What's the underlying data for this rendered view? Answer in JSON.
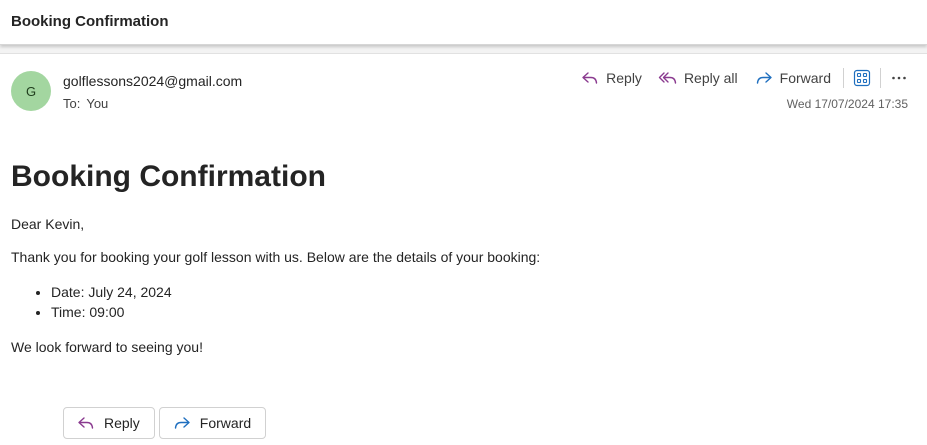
{
  "subject": "Booking Confirmation",
  "sender": {
    "initial": "G",
    "email": "golflessons2024@gmail.com",
    "to_label": "To:",
    "to_value": "You"
  },
  "toolbar": {
    "reply_label": "Reply",
    "reply_all_label": "Reply all",
    "forward_label": "Forward",
    "apps_icon": "apps-grid-icon",
    "more_icon": "more-horizontal-icon"
  },
  "timestamp": "Wed 17/07/2024 17:35",
  "body": {
    "heading": "Booking Confirmation",
    "greeting": "Dear Kevin,",
    "intro": "Thank you for booking your golf lesson with us. Below are the details of your booking:",
    "details": [
      "Date: July 24, 2024",
      "Time: 09:00"
    ],
    "closing": "We look forward to seeing you!"
  },
  "bottom_actions": {
    "reply_label": "Reply",
    "forward_label": "Forward"
  },
  "colors": {
    "reply_icon": "#8a3a8f",
    "forward_icon": "#1f6fbf",
    "avatar_bg": "#a3d6a0",
    "apps_icon": "#1f6fbf"
  }
}
